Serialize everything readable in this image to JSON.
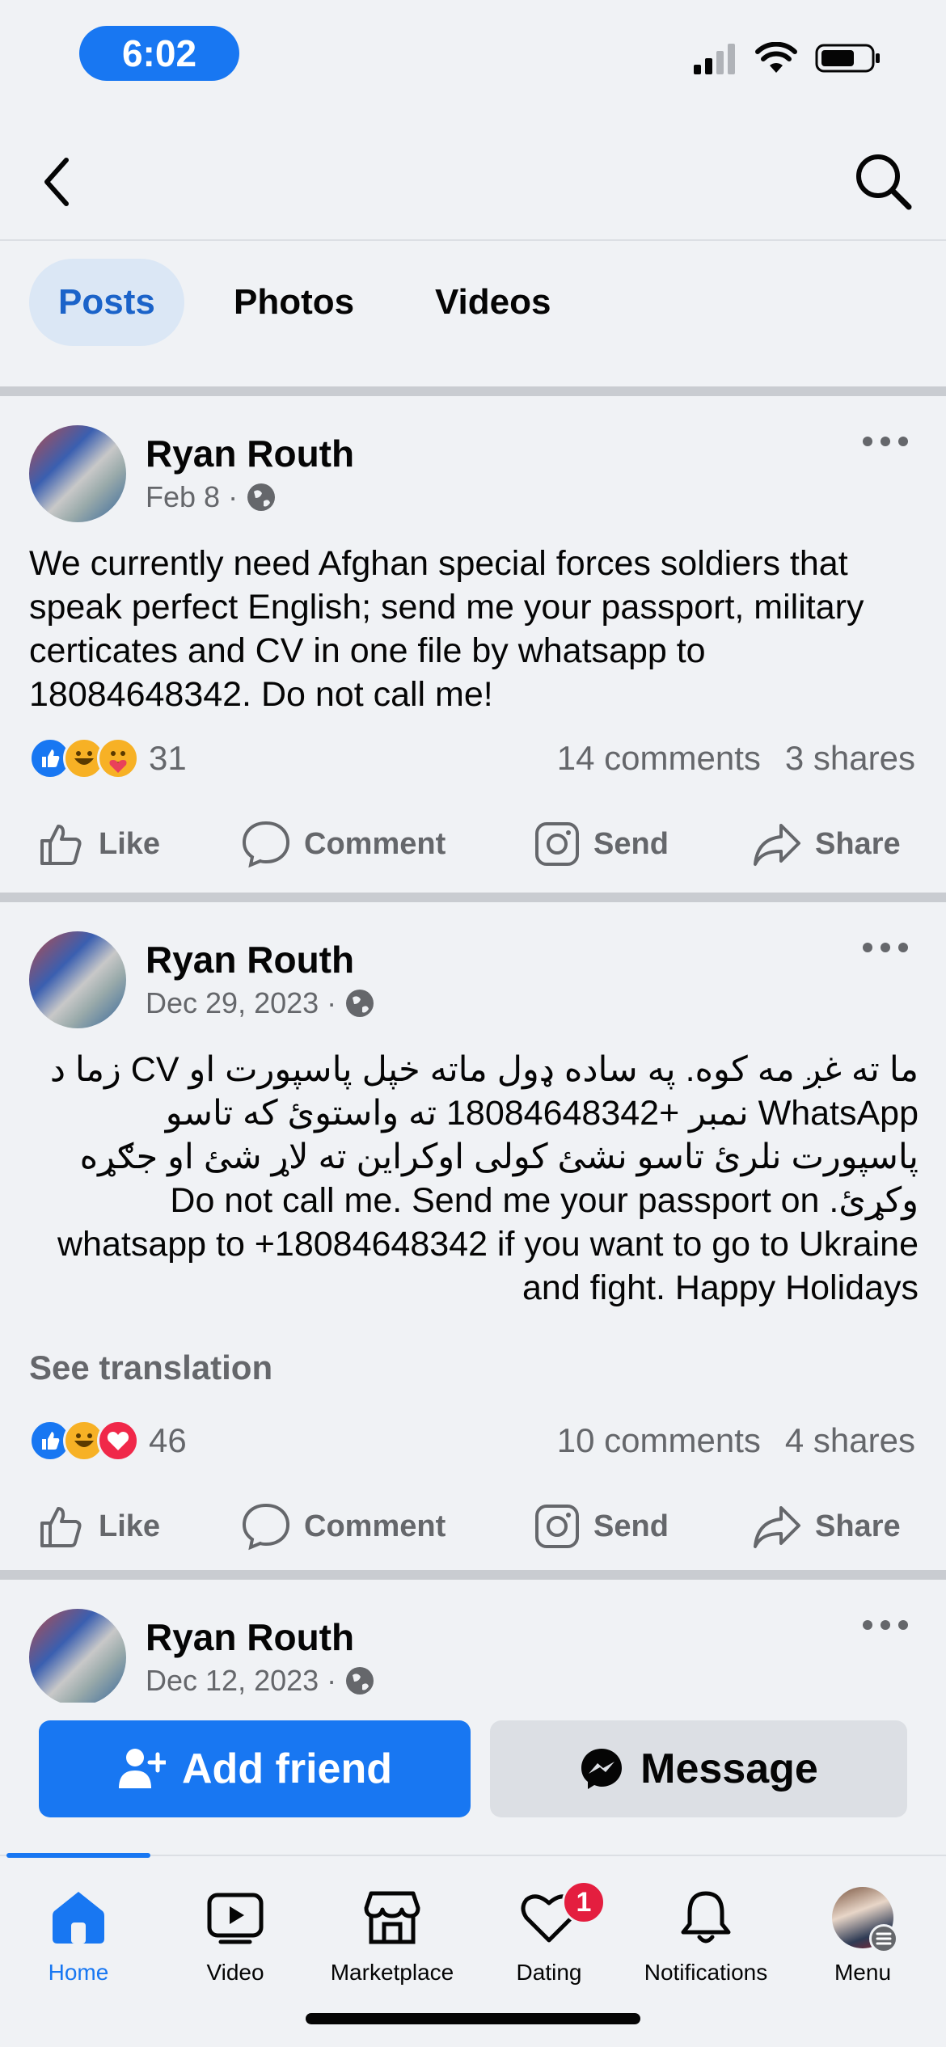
{
  "status_bar": {
    "time": "6:02"
  },
  "tabs": [
    {
      "label": "Posts",
      "active": true
    },
    {
      "label": "Photos",
      "active": false
    },
    {
      "label": "Videos",
      "active": false
    }
  ],
  "posts": [
    {
      "author": "Ryan Routh",
      "date": "Feb 8",
      "privacy_icon": "globe-icon",
      "text": "We currently need Afghan special forces soldiers that speak perfect English; send me your passport, military certicates and CV in one file by whatsapp to 18084648342. Do not call me!",
      "reactions": [
        "like",
        "haha",
        "care"
      ],
      "reaction_count": "31",
      "comments": "14 comments",
      "shares": "3 shares"
    },
    {
      "author": "Ryan Routh",
      "date": "Dec 29, 2023",
      "privacy_icon": "globe-icon",
      "text": "ما ته غږ مه کوه.  په ساده ډول ماته خپل پاسپورت او CV زما د WhatsApp نمبر +18084648342 ته واستوئ که تاسو پاسپورت نلرئ تاسو نشئ کولی اوکراین ته لاړ شئ او جګړه وکړئ. Do not call me. Send me your passport on whatsapp to +18084648342 if you want to go to Ukraine and fight. Happy Holidays",
      "see_translation": "See translation",
      "reactions": [
        "like",
        "haha",
        "love"
      ],
      "reaction_count": "46",
      "comments": "10 comments",
      "shares": "4 shares"
    },
    {
      "author": "Ryan Routh",
      "date": "Dec 12, 2023",
      "privacy_icon": "globe-icon"
    }
  ],
  "actions": {
    "like": "Like",
    "comment": "Comment",
    "send": "Send",
    "share": "Share"
  },
  "buttons": {
    "add_friend": "Add friend",
    "message": "Message"
  },
  "tab_bar": [
    {
      "label": "Home",
      "icon": "home-icon",
      "active": true
    },
    {
      "label": "Video",
      "icon": "video-icon"
    },
    {
      "label": "Marketplace",
      "icon": "marketplace-icon"
    },
    {
      "label": "Dating",
      "icon": "dating-icon",
      "badge": "1"
    },
    {
      "label": "Notifications",
      "icon": "bell-icon"
    },
    {
      "label": "Menu",
      "icon": "menu-avatar"
    }
  ],
  "colors": {
    "accent": "#1877f2",
    "secondary_text": "#65676b",
    "badge": "#e41e3f"
  }
}
